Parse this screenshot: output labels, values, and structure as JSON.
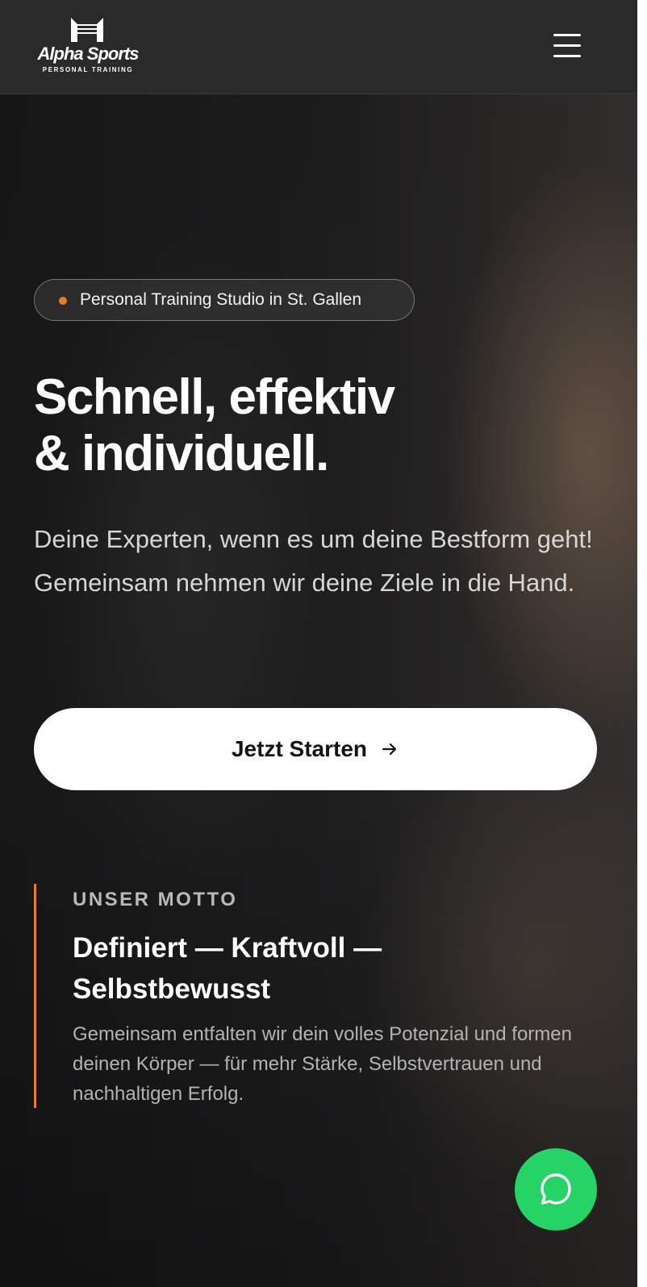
{
  "brand": {
    "name": "Alpha Sports",
    "tagline": "PERSONAL TRAINING",
    "logo_icon": "alpha-sports-logo-icon"
  },
  "header": {
    "menu_icon": "hamburger-menu-icon"
  },
  "hero": {
    "badge": "Personal Training Studio in St. Gallen",
    "title_line1": "Schnell, effektiv",
    "title_line2": "& individuell.",
    "lead": "Deine Experten, wenn es um deine Bestform geht! Gemeinsam nehmen wir deine Ziele in die Hand.",
    "cta_label": "Jetzt Starten",
    "cta_icon": "arrow-right-icon"
  },
  "motto": {
    "kicker": "UNSER MOTTO",
    "title": "Definiert — Kraftvoll — Selbstbewusst",
    "text": "Gemeinsam entfalten wir dein volles Potenzial und formen deinen Körper — für mehr Stärke, Selbstvertrauen und nachhaltigen Erfolg."
  },
  "chat": {
    "icon": "whatsapp-chat-icon"
  },
  "colors": {
    "accent": "#ea7c2b",
    "chat": "#25d366",
    "header_bg": "#2a2a2a"
  }
}
